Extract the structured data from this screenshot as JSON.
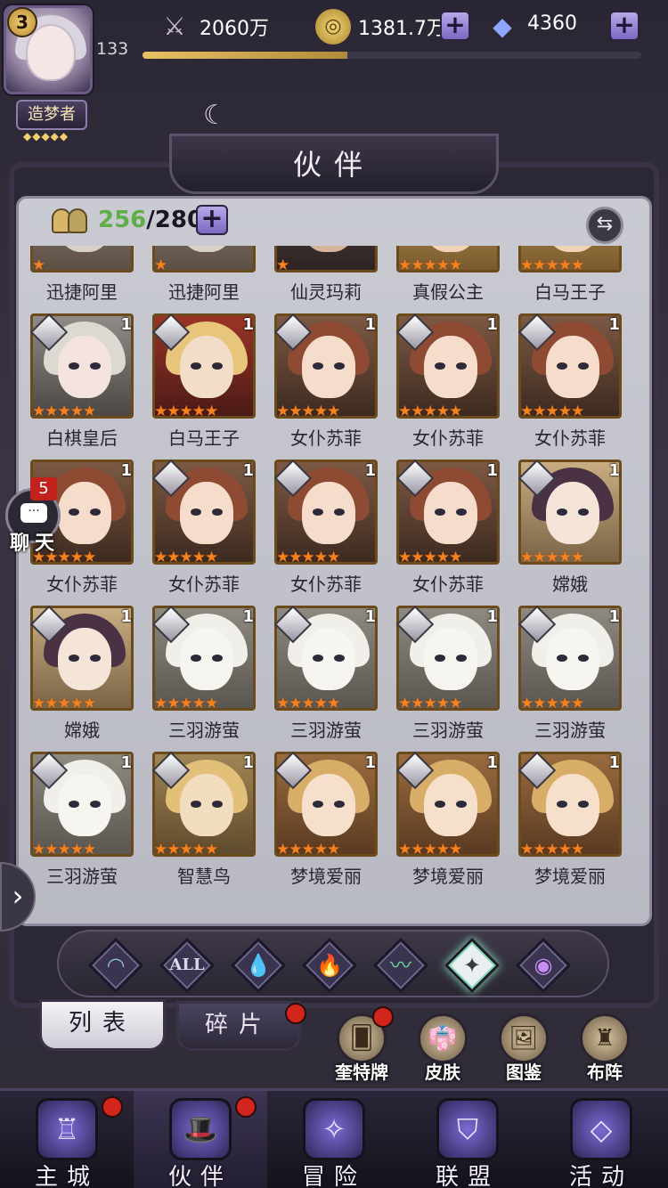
{
  "player": {
    "level": "3",
    "number": "133",
    "title": "造梦者",
    "title_stars": "◆◆◆◆◆",
    "xp_fraction": 0.41
  },
  "resources": {
    "sword": {
      "icon": "sword-icon",
      "value": "2060万"
    },
    "gold": {
      "icon": "gold-coin-icon",
      "value": "1381.7万",
      "plus": "+"
    },
    "gem": {
      "icon": "diamond-gem-icon",
      "value": "4360",
      "plus": "+"
    }
  },
  "header": {
    "title": "伙伴"
  },
  "companion_count": {
    "current": "256",
    "separator": "/",
    "max": "280",
    "plus": "+"
  },
  "colors": {
    "star": "#f6821f",
    "count_current": "#5fae47",
    "reddot": "#d2251c"
  },
  "companions": [
    {
      "name": "迅捷阿里",
      "stars": "★",
      "tier": "",
      "shard": false,
      "palette": "owl"
    },
    {
      "name": "迅捷阿里",
      "stars": "★",
      "tier": "",
      "shard": false,
      "palette": "owl"
    },
    {
      "name": "仙灵玛莉",
      "stars": "★",
      "tier": "",
      "shard": false,
      "palette": "dark"
    },
    {
      "name": "真假公主",
      "stars": "★★★★★",
      "tier": "",
      "shard": false,
      "palette": "gold"
    },
    {
      "name": "白马王子",
      "stars": "★★★★★",
      "tier": "",
      "shard": false,
      "palette": "gold"
    },
    {
      "name": "白棋皇后",
      "stars": "★★★★★",
      "tier": "1",
      "shard": true,
      "palette": "silver"
    },
    {
      "name": "白马王子",
      "stars": "★★★★★",
      "tier": "1",
      "shard": true,
      "palette": "blonde"
    },
    {
      "name": "女仆苏菲",
      "stars": "★★★★★",
      "tier": "1",
      "shard": true,
      "palette": "maid"
    },
    {
      "name": "女仆苏菲",
      "stars": "★★★★★",
      "tier": "1",
      "shard": true,
      "palette": "maid"
    },
    {
      "name": "女仆苏菲",
      "stars": "★★★★★",
      "tier": "1",
      "shard": true,
      "palette": "maid"
    },
    {
      "name": "女仆苏菲",
      "stars": "★★★★★",
      "tier": "1",
      "shard": false,
      "palette": "maid"
    },
    {
      "name": "女仆苏菲",
      "stars": "★★★★★",
      "tier": "1",
      "shard": true,
      "palette": "maid"
    },
    {
      "name": "女仆苏菲",
      "stars": "★★★★★",
      "tier": "1",
      "shard": true,
      "palette": "maid"
    },
    {
      "name": "女仆苏菲",
      "stars": "★★★★★",
      "tier": "1",
      "shard": true,
      "palette": "maid"
    },
    {
      "name": "嫦娥",
      "stars": "★★★★★",
      "tier": "1",
      "shard": true,
      "palette": "moon"
    },
    {
      "name": "嫦娥",
      "stars": "★★★★★",
      "tier": "1",
      "shard": true,
      "palette": "moon"
    },
    {
      "name": "三羽游萤",
      "stars": "★★★★★",
      "tier": "1",
      "shard": true,
      "palette": "cat"
    },
    {
      "name": "三羽游萤",
      "stars": "★★★★★",
      "tier": "1",
      "shard": true,
      "palette": "cat"
    },
    {
      "name": "三羽游萤",
      "stars": "★★★★★",
      "tier": "1",
      "shard": true,
      "palette": "cat"
    },
    {
      "name": "三羽游萤",
      "stars": "★★★★★",
      "tier": "1",
      "shard": true,
      "palette": "cat"
    },
    {
      "name": "三羽游萤",
      "stars": "★★★★★",
      "tier": "1",
      "shard": true,
      "palette": "cat"
    },
    {
      "name": "智慧鸟",
      "stars": "★★★★★",
      "tier": "1",
      "shard": true,
      "palette": "wise"
    },
    {
      "name": "梦境爱丽",
      "stars": "★★★★★",
      "tier": "1",
      "shard": true,
      "palette": "alice"
    },
    {
      "name": "梦境爱丽",
      "stars": "★★★★★",
      "tier": "1",
      "shard": true,
      "palette": "alice"
    },
    {
      "name": "梦境爱丽",
      "stars": "★★★★★",
      "tier": "1",
      "shard": true,
      "palette": "alice"
    }
  ],
  "filters": [
    {
      "name": "filter-light-icon",
      "glyph": "◠",
      "color": "#8fc4e8"
    },
    {
      "name": "filter-all-icon",
      "glyph": "ALL",
      "color": "#dcd6f0"
    },
    {
      "name": "filter-water-icon",
      "glyph": "💧",
      "color": "#5aa8f0"
    },
    {
      "name": "filter-fire-icon",
      "glyph": "🔥",
      "color": "#f26a3c"
    },
    {
      "name": "filter-wind-icon",
      "glyph": "〰",
      "color": "#6fd29b"
    },
    {
      "name": "filter-star-icon",
      "glyph": "✦",
      "color": "#3b3944"
    },
    {
      "name": "filter-dark-icon",
      "glyph": "◉",
      "color": "#c58ef0"
    }
  ],
  "tabs": {
    "list": "列表",
    "shards": "碎片"
  },
  "tools": [
    {
      "name": "tarot-button",
      "icon": "tarot-card-icon",
      "glyph": "🂠",
      "label": "奎特牌",
      "reddot": true
    },
    {
      "name": "skin-button",
      "icon": "skin-icon",
      "glyph": "👘",
      "label": "皮肤",
      "reddot": false
    },
    {
      "name": "gallery-button",
      "icon": "gallery-icon",
      "glyph": "🖼",
      "label": "图鉴",
      "reddot": false
    },
    {
      "name": "formation-button",
      "icon": "formation-icon",
      "glyph": "♜",
      "label": "布阵",
      "reddot": false
    }
  ],
  "nav": [
    {
      "name": "nav-main-city",
      "icon": "castle-icon",
      "glyph": "♖",
      "label": "主城",
      "reddot": true,
      "active": false
    },
    {
      "name": "nav-companions",
      "icon": "witch-hat-icon",
      "glyph": "🎩",
      "label": "伙伴",
      "reddot": true,
      "active": true
    },
    {
      "name": "nav-adventure",
      "icon": "adventure-orb-icon",
      "glyph": "✧",
      "label": "冒险",
      "reddot": false,
      "active": false
    },
    {
      "name": "nav-alliance",
      "icon": "shield-icon",
      "glyph": "⛉",
      "label": "联盟",
      "reddot": false,
      "active": false
    },
    {
      "name": "nav-events",
      "icon": "cards-icon",
      "glyph": "◇",
      "label": "活动",
      "reddot": false,
      "active": false
    }
  ],
  "chat": {
    "badge": "5",
    "label": "聊天",
    "bubble": "···"
  },
  "side_arrow": "›"
}
